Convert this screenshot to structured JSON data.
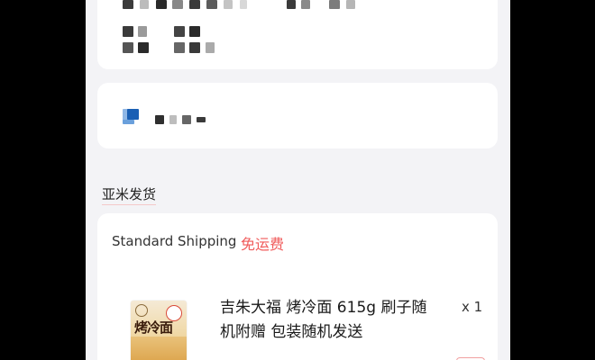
{
  "seller": {
    "label": "亚米发货"
  },
  "order": {
    "shipping_method": "Standard Shipping",
    "shipping_fee": "免运费",
    "product_name": "吉朱大福 烤冷面 615g 刷子随机附赠 包装随机发送",
    "quantity": "x 1",
    "thumbnail_text": "烤冷面"
  },
  "colors": {
    "accent": "#f05a5a",
    "background": "#f3f3f6"
  }
}
